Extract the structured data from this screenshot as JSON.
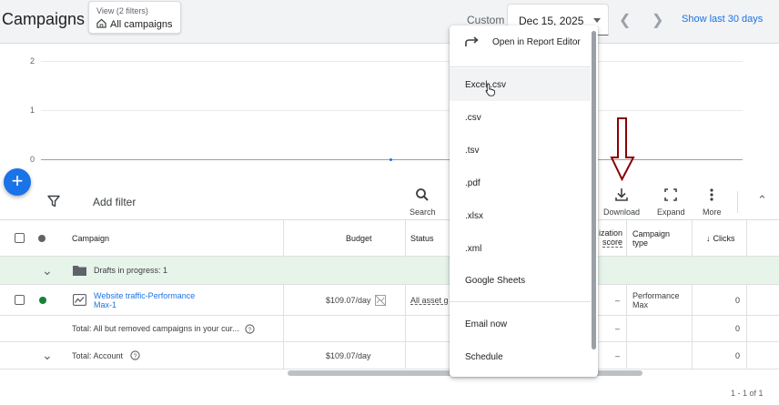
{
  "header": {
    "title": "Campaigns",
    "view_sub": "View (2 filters)",
    "view_main": "All campaigns",
    "range_label": "Custom",
    "date_value": "Dec 15, 2025",
    "show_last": "Show last 30 days"
  },
  "chart": {
    "y_ticks": [
      "2",
      "1",
      "0"
    ]
  },
  "toolbar": {
    "add_filter": "Add filter",
    "search": "Search",
    "download": "Download",
    "expand": "Expand",
    "more": "More"
  },
  "table": {
    "headers": {
      "campaign": "Campaign",
      "budget": "Budget",
      "status": "Status",
      "opt_score_1": "ization",
      "opt_score_2": "score",
      "campaign_type_1": "Campaign",
      "campaign_type_2": "type",
      "clicks": "Clicks"
    },
    "drafts": "Drafts in progress: 1",
    "campaign_row": {
      "name_1": "Website traffic-Performance",
      "name_2": "Max-1",
      "budget": "$109.07/day",
      "status": "All asset g",
      "opt_score": "–",
      "type_1": "Performance",
      "type_2": "Max",
      "clicks": "0"
    },
    "total_all": {
      "label": "Total: All but removed campaigns in your cur...",
      "opt_score": "–",
      "clicks": "0"
    },
    "total_account": {
      "label": "Total: Account",
      "budget": "$109.07/day",
      "opt_score": "–",
      "clicks": "0"
    },
    "pager": "1 - 1 of 1"
  },
  "menu": {
    "items": [
      "Open in Report Editor",
      "Excel .csv",
      ".csv",
      ".tsv",
      ".pdf",
      ".xlsx",
      ".xml",
      "Google Sheets",
      "Email now",
      "Schedule"
    ]
  },
  "colors": {
    "accent": "#1a73e8",
    "enabled_dot": "#188038",
    "annotation_arrow": "#8b0000",
    "drafts_bg": "#e6f4ea"
  }
}
